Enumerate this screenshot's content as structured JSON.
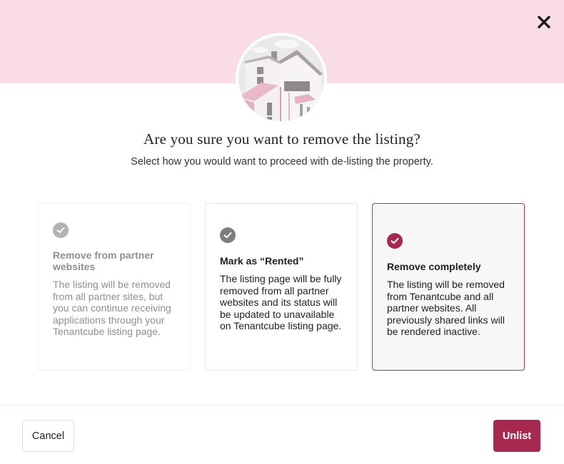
{
  "dialog": {
    "title": "Are you sure you want to remove the listing?",
    "subtitle": "Select how you would want to proceed with de-listing the property."
  },
  "icons": {
    "close": "close-icon",
    "illustration": "house-illustration",
    "check": "checkmark-icon"
  },
  "colors": {
    "top_band": "#fadce4",
    "accent": "#a8294f",
    "selected_border": "#a23a5e"
  },
  "options": [
    {
      "title": "Remove from partner websites",
      "description": "The listing will be removed from all partner sites, but you can continue receiving applications through your Tenantcube listing page.",
      "state": "disabled"
    },
    {
      "title": "Mark as “Rented”",
      "description": "The listing page will be fully removed from all partner websites and its status will be updated to unavailable on Tenantcube listing page.",
      "state": "unselected"
    },
    {
      "title": "Remove completely",
      "description": "The listing will be removed from Tenantcube and all partner websites. All previously shared links will be rendered inactive.",
      "state": "selected"
    }
  ],
  "footer": {
    "cancel_label": "Cancel",
    "unlist_label": "Unlist"
  }
}
